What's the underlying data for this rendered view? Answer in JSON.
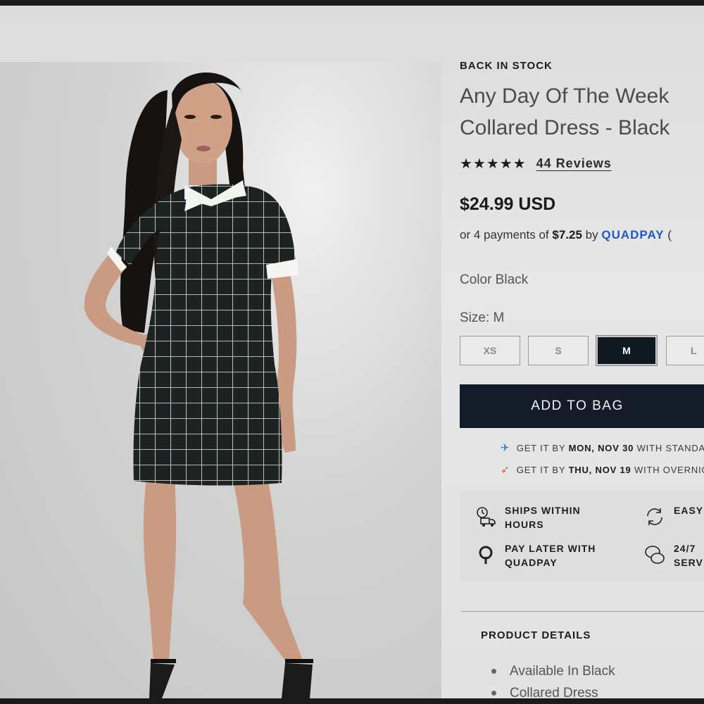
{
  "product": {
    "eyebrow": "BACK IN STOCK",
    "title_line1": "Any Day Of The Week",
    "title_line2": "Collared Dress - Black",
    "stars": "★★★★★",
    "rating_value": 5,
    "reviews": "44 Reviews",
    "price": "$24.99 USD",
    "installments": {
      "prefix": "or 4 payments of",
      "amount": "$7.25",
      "by": "by",
      "provider": "QUADPAY",
      "info_glyph": "("
    },
    "color_label": "Color Black",
    "size_label": "Size: M",
    "sizes": [
      "XS",
      "S",
      "M",
      "L"
    ],
    "selected_size": "M",
    "add_to_bag": "ADD TO BAG"
  },
  "shipping": [
    {
      "icon": "plane-icon",
      "pre": "GET IT BY",
      "date": "MON, NOV 30",
      "post": "WITH STANDARD"
    },
    {
      "icon": "rocket-icon",
      "pre": "GET IT BY",
      "date": "THU, NOV 19",
      "post": "WITH OVERNIGHT"
    }
  ],
  "perks": [
    {
      "icon": "delivery-truck-clock-icon",
      "line1": "SHIPS WITHIN",
      "line2": "HOURS"
    },
    {
      "icon": "refresh-arrows-icon",
      "line1": "EASY",
      "line2": ""
    },
    {
      "icon": "quadpay-logo-icon",
      "line1": "PAY LATER WITH",
      "line2": "QUADPAY"
    },
    {
      "icon": "chat-bubbles-icon",
      "line1": "24/7",
      "line2": "SERV"
    }
  ],
  "details": {
    "title": "PRODUCT DETAILS",
    "items": [
      "Available In Black",
      "Collared Dress"
    ]
  },
  "colors": {
    "button_dark": "#141c2a",
    "quadpay_blue": "#2356c7",
    "dress": "#1c2322",
    "grid": "#e8e6dc"
  }
}
